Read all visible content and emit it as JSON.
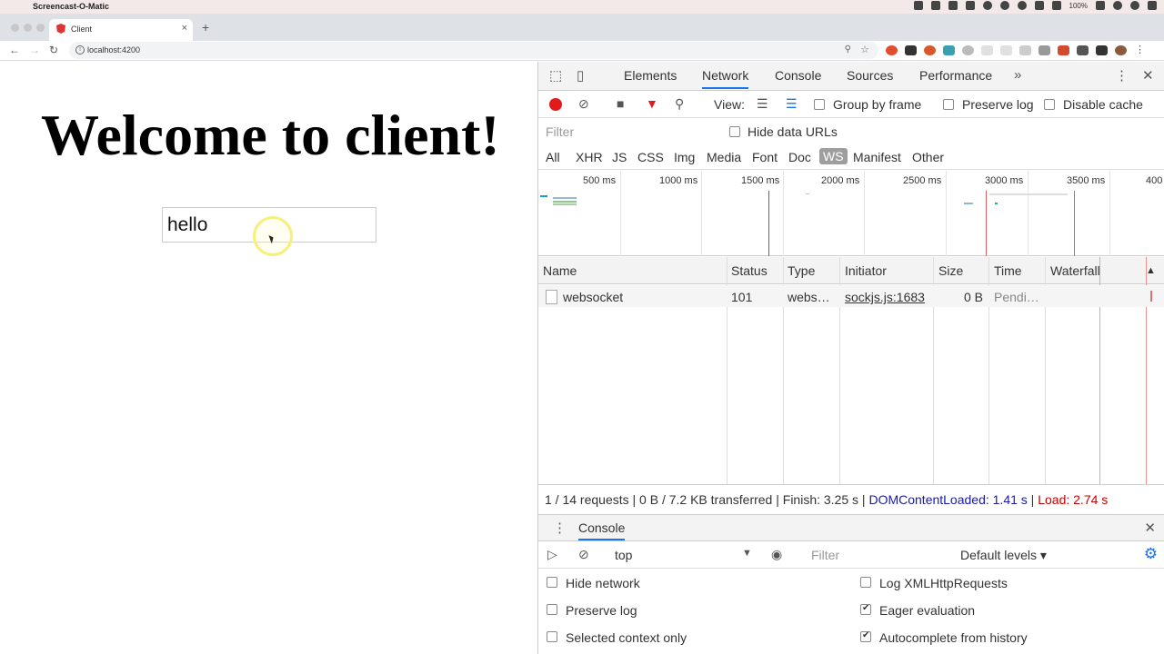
{
  "menubar": {
    "app_name": "Screencast-O-Matic",
    "battery": "100%"
  },
  "browser": {
    "tab_title": "Client",
    "url": "localhost:4200"
  },
  "page": {
    "heading": "Welcome to client!",
    "input_value": "hello"
  },
  "devtools": {
    "tabs": [
      "Elements",
      "Network",
      "Console",
      "Sources",
      "Performance"
    ],
    "active_tab": "Network",
    "network_toolbar": {
      "view_label": "View:",
      "group_by_frame": "Group by frame",
      "preserve_log": "Preserve log",
      "disable_cache": "Disable cache"
    },
    "filter_placeholder": "Filter",
    "hide_data_urls": "Hide data URLs",
    "types": [
      "All",
      "XHR",
      "JS",
      "CSS",
      "Img",
      "Media",
      "Font",
      "Doc",
      "WS",
      "Manifest",
      "Other"
    ],
    "active_type": "WS",
    "overview_ticks": [
      "500 ms",
      "1000 ms",
      "1500 ms",
      "2000 ms",
      "2500 ms",
      "3000 ms",
      "3500 ms",
      "400"
    ],
    "columns": [
      "Name",
      "Status",
      "Type",
      "Initiator",
      "Size",
      "Time",
      "Waterfall"
    ],
    "rows": [
      {
        "name": "websocket",
        "status": "101",
        "type": "webs…",
        "initiator": "sockjs.js:1683",
        "size": "0 B",
        "time": "Pendi…"
      }
    ],
    "summary": {
      "requests": "1 / 14 requests",
      "transferred": "0 B / 7.2 KB transferred",
      "finish": "Finish: 3.25 s",
      "dom_content_loaded": "DOMContentLoaded: 1.41 s",
      "load": "Load: 2.74 s"
    },
    "console": {
      "title": "Console",
      "context": "top",
      "filter_placeholder": "Filter",
      "levels": "Default levels",
      "options": {
        "hide_network": "Hide network",
        "preserve_log": "Preserve log",
        "selected_context_only": "Selected context only",
        "log_xhr": "Log XMLHttpRequests",
        "eager_evaluation": "Eager evaluation",
        "autocomplete": "Autocomplete from history"
      }
    }
  },
  "colors": {
    "record": "#e21a1a",
    "dom_content_loaded": "#1a1aa6",
    "load": "#c80000",
    "accent": "#1a73e8"
  }
}
